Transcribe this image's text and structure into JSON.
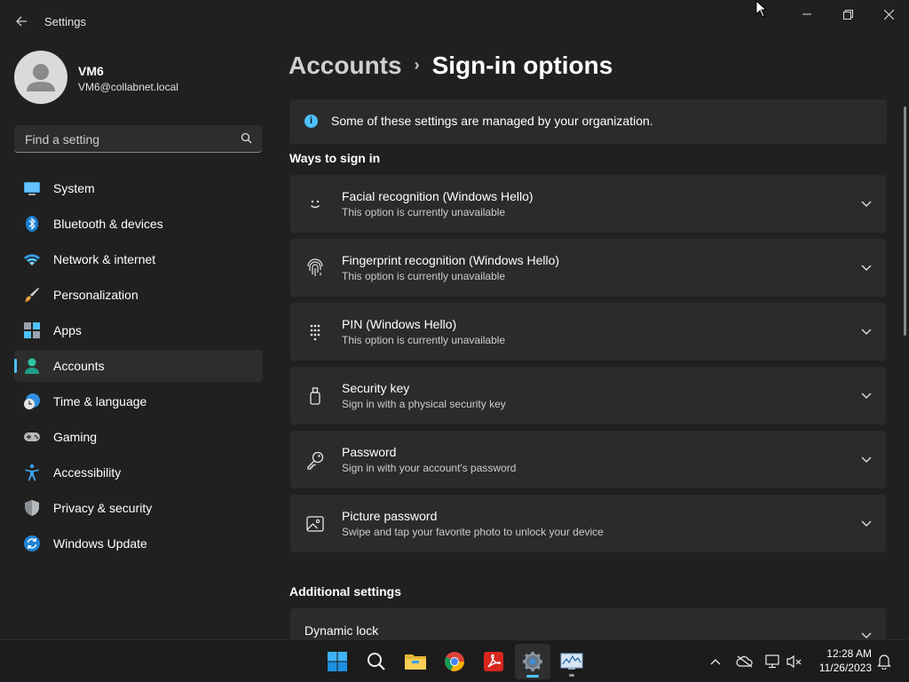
{
  "window": {
    "title": "Settings"
  },
  "user": {
    "name": "VM6",
    "email": "VM6@collabnet.local"
  },
  "search": {
    "placeholder": "Find a setting"
  },
  "nav": [
    {
      "label": "System",
      "icon": "monitor-icon"
    },
    {
      "label": "Bluetooth & devices",
      "icon": "bluetooth-icon"
    },
    {
      "label": "Network & internet",
      "icon": "wifi-icon"
    },
    {
      "label": "Personalization",
      "icon": "brush-icon"
    },
    {
      "label": "Apps",
      "icon": "apps-icon"
    },
    {
      "label": "Accounts",
      "icon": "person-icon",
      "selected": true
    },
    {
      "label": "Time & language",
      "icon": "globe-clock-icon"
    },
    {
      "label": "Gaming",
      "icon": "gamepad-icon"
    },
    {
      "label": "Accessibility",
      "icon": "accessibility-icon"
    },
    {
      "label": "Privacy & security",
      "icon": "shield-icon"
    },
    {
      "label": "Windows Update",
      "icon": "update-icon"
    }
  ],
  "breadcrumb": {
    "parent": "Accounts",
    "separator": "›",
    "current": "Sign-in options"
  },
  "info": {
    "text": "Some of these settings are managed by your organization."
  },
  "ways_to_sign_in": {
    "heading": "Ways to sign in",
    "items": [
      {
        "title": "Facial recognition (Windows Hello)",
        "subtitle": "This option is currently unavailable",
        "icon": "face-icon"
      },
      {
        "title": "Fingerprint recognition (Windows Hello)",
        "subtitle": "This option is currently unavailable",
        "icon": "fingerprint-icon"
      },
      {
        "title": "PIN (Windows Hello)",
        "subtitle": "This option is currently unavailable",
        "icon": "pin-keypad-icon"
      },
      {
        "title": "Security key",
        "subtitle": "Sign in with a physical security key",
        "icon": "usb-key-icon"
      },
      {
        "title": "Password",
        "subtitle": "Sign in with your account's password",
        "icon": "key-icon"
      },
      {
        "title": "Picture password",
        "subtitle": "Swipe and tap your favorite photo to unlock your device",
        "icon": "picture-icon"
      }
    ]
  },
  "additional": {
    "heading": "Additional settings",
    "items": [
      {
        "title": "Dynamic lock"
      }
    ]
  },
  "taskbar": {
    "apps": [
      "start-icon",
      "search-icon",
      "file-explorer-icon",
      "chrome-icon",
      "acrobat-icon",
      "settings-gear-icon",
      "monitor-app-icon"
    ],
    "clock": {
      "time": "12:28 AM",
      "date": "11/26/2023"
    }
  },
  "colors": {
    "accent": "#4cc2ff",
    "background": "#202020",
    "card": "#2b2b2b"
  }
}
